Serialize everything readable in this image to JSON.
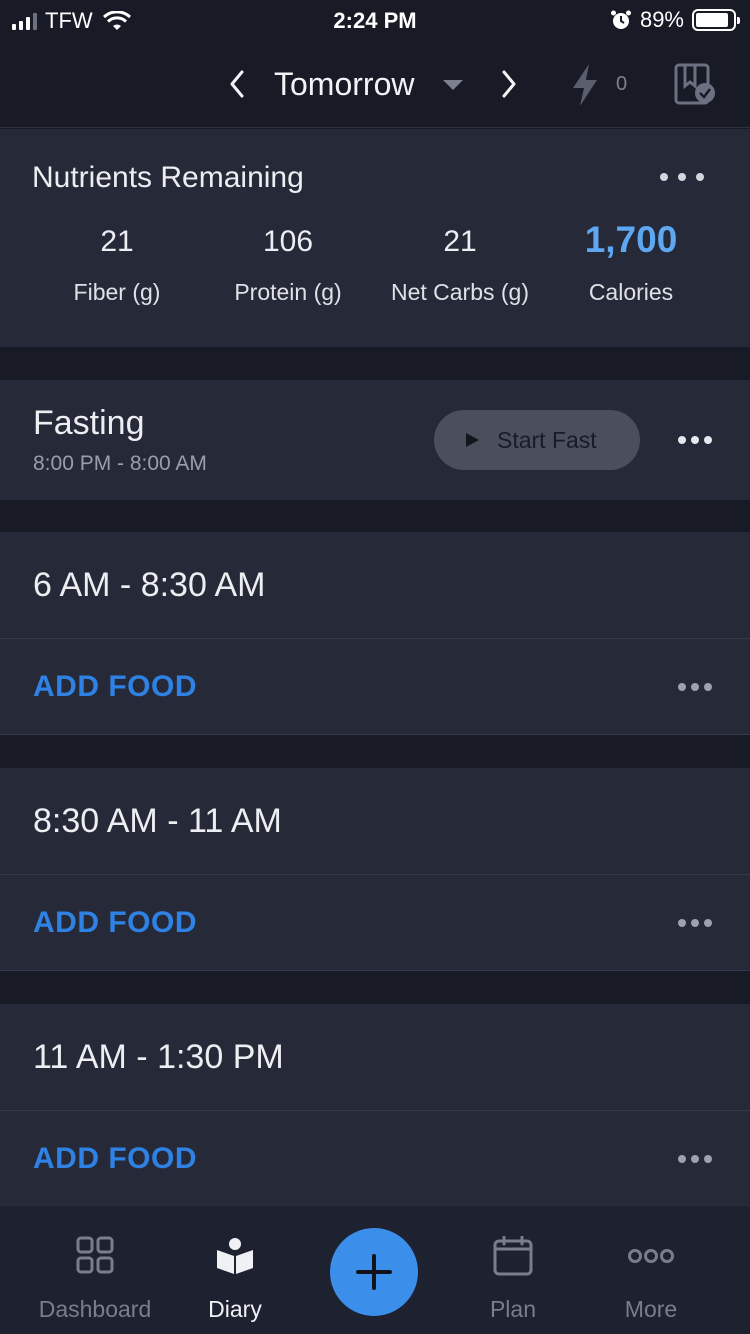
{
  "status_bar": {
    "carrier": "TFW",
    "time": "2:24 PM",
    "battery": "89%",
    "battery_level": 0.89
  },
  "header": {
    "title": "Tomorrow",
    "bolt_count": "0"
  },
  "nutrients": {
    "title": "Nutrients Remaining",
    "items": [
      {
        "value": "21",
        "label": "Fiber (g)"
      },
      {
        "value": "106",
        "label": "Protein (g)"
      },
      {
        "value": "21",
        "label": "Net Carbs (g)"
      },
      {
        "value": "1,700",
        "label": "Calories"
      }
    ],
    "accent_color": "#5ea8f2"
  },
  "fasting": {
    "title": "Fasting",
    "time_range": "8:00 PM - 8:00 AM",
    "button_label": "Start Fast"
  },
  "meals": [
    {
      "title": "6 AM - 8:30 AM",
      "add_label": "ADD FOOD"
    },
    {
      "title": "8:30 AM - 11 AM",
      "add_label": "ADD FOOD"
    },
    {
      "title": "11 AM - 1:30 PM",
      "add_label": "ADD FOOD"
    }
  ],
  "tabbar": {
    "tabs": [
      {
        "label": "Dashboard",
        "icon": "grid-icon"
      },
      {
        "label": "Diary",
        "icon": "book-person-icon",
        "active": true
      },
      {
        "label": "Plan",
        "icon": "calendar-icon"
      },
      {
        "label": "More",
        "icon": "more-circles-icon"
      }
    ],
    "fab_icon": "plus-icon",
    "fab_color": "#3b8fea"
  }
}
